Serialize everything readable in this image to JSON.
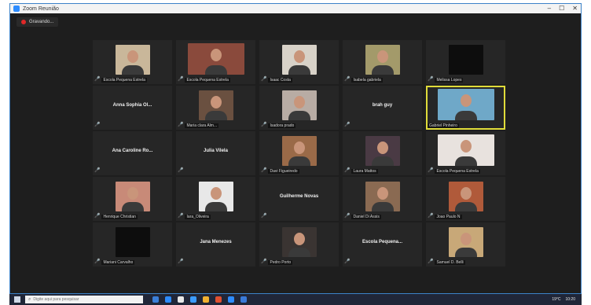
{
  "window": {
    "title": "Zoom Reunião",
    "controls": [
      "–",
      "☐",
      "✕"
    ]
  },
  "recording": {
    "label": "Gravando..."
  },
  "colors": {
    "active_speaker": "#e0dc3a",
    "mic_muted": "#e03030",
    "tile_bg": "#262626"
  },
  "participants": [
    {
      "name": "Escola Pequena Estrela",
      "kind": "video",
      "thumb": "#c9b79a",
      "muted": true
    },
    {
      "name": "Escola Pequena Estrela",
      "kind": "video",
      "thumb": "#8a4a3c",
      "muted": true,
      "wide": true
    },
    {
      "name": "Isaac Costa",
      "kind": "video",
      "thumb": "#d8d2c8",
      "muted": true
    },
    {
      "name": "Isabela gabriela",
      "kind": "video",
      "thumb": "#a39a6a",
      "muted": true
    },
    {
      "name": "Melissa Lopes",
      "kind": "black",
      "thumb": "#0d0d0d",
      "muted": true
    },
    {
      "name": "Anna Sophia Ol...",
      "kind": "name",
      "muted": true,
      "label": ""
    },
    {
      "name": "Maria clara Alm...",
      "kind": "video",
      "thumb": "#6a5040",
      "muted": true
    },
    {
      "name": "Isadora prado",
      "kind": "video",
      "thumb": "#b8aca4",
      "muted": true
    },
    {
      "name": "brah guy",
      "kind": "name",
      "muted": true,
      "label": ""
    },
    {
      "name": "Gabriel Pinheiro",
      "kind": "video",
      "thumb": "#6fa8c8",
      "muted": false,
      "wide": true,
      "active": true
    },
    {
      "name": "Ana Caroline Ro...",
      "kind": "name",
      "muted": true,
      "label": ""
    },
    {
      "name": "Julia Vilela",
      "kind": "name",
      "muted": true,
      "label": ""
    },
    {
      "name": "Davi Figueiredo",
      "kind": "video",
      "thumb": "#9a6a48",
      "muted": true
    },
    {
      "name": "Laura Mattos",
      "kind": "video",
      "thumb": "#4a3a44",
      "muted": true
    },
    {
      "name": "Escola Pequena Estrela",
      "kind": "video",
      "thumb": "#e8e2de",
      "muted": true,
      "wide": true
    },
    {
      "name": "Henrique Christian",
      "kind": "video",
      "thumb": "#c88a78",
      "muted": true
    },
    {
      "name": "Iara_Oliveira",
      "kind": "video",
      "thumb": "#e8e8e8",
      "muted": true
    },
    {
      "name": "Guilherme Novas",
      "kind": "name",
      "muted": true,
      "label": ""
    },
    {
      "name": "Daniel Di Assis",
      "kind": "video",
      "thumb": "#8a6a52",
      "muted": true
    },
    {
      "name": "Joao Paulo N",
      "kind": "video",
      "thumb": "#b05a3a",
      "muted": true
    },
    {
      "name": "Mariani Carvalho",
      "kind": "black",
      "thumb": "#0d0d0d",
      "muted": true
    },
    {
      "name": "Jana Menezes",
      "kind": "name",
      "muted": true,
      "label": ""
    },
    {
      "name": "Pedro Porto",
      "kind": "video",
      "thumb": "#3a3432",
      "muted": true
    },
    {
      "name": "Escola Pequena...",
      "kind": "name",
      "muted": true,
      "label": ""
    },
    {
      "name": "Samuel D. Belli",
      "kind": "video",
      "thumb": "#c8a878",
      "muted": true
    }
  ],
  "taskbar": {
    "search_placeholder": "Digite aqui para pesquisar",
    "tray_temp": "19°C",
    "tray_time": "10:20",
    "app_icons": [
      "#3b7fd8",
      "#2d8cff",
      "#e8e8e8",
      "#3b9cff",
      "#f0b030",
      "#e05030",
      "#2d8cff",
      "#3a7ad8"
    ]
  }
}
